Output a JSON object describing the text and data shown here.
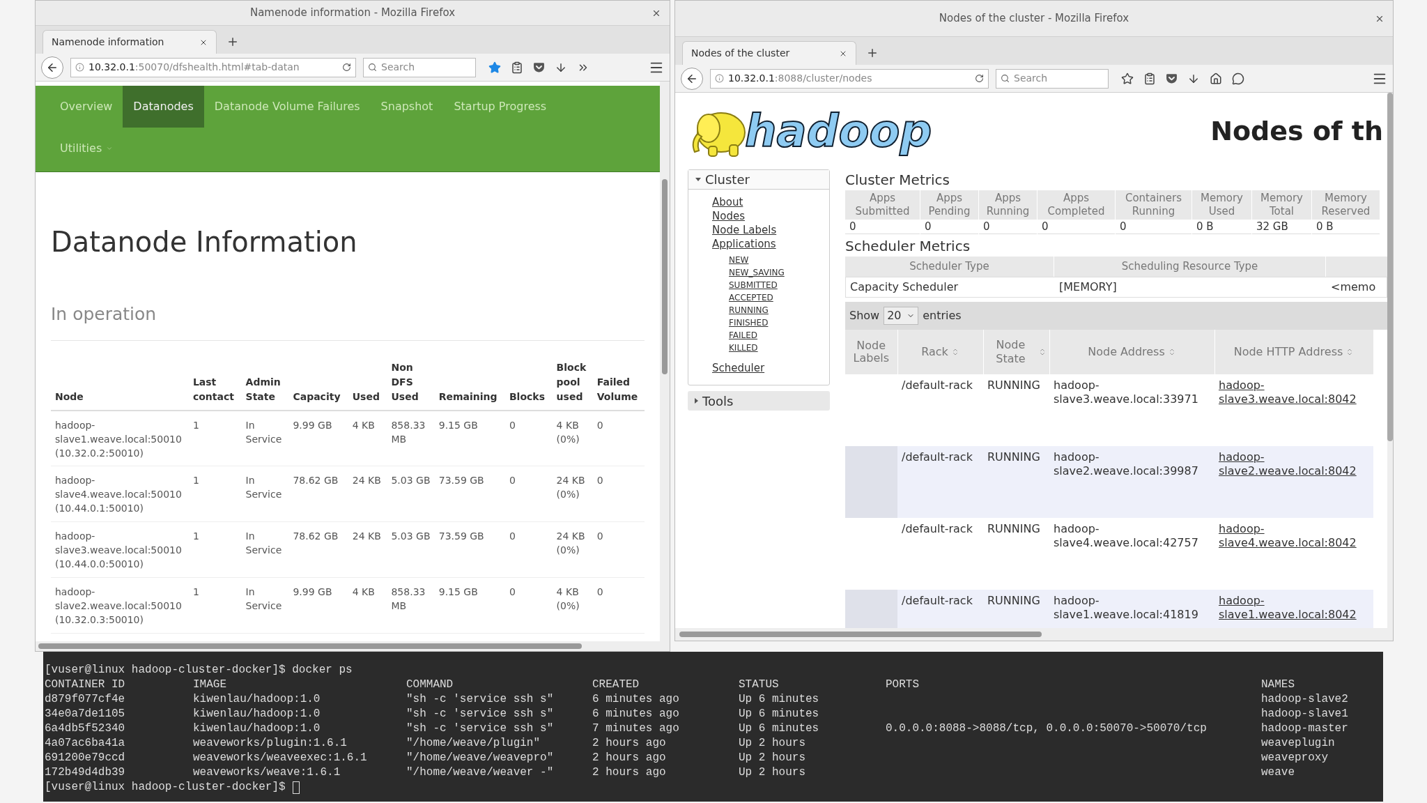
{
  "left_window": {
    "title": "Namenode information - Mozilla Firefox",
    "tab": "Namenode information",
    "url_host": "10.32.0.1",
    "url_path": ":50070/dfshealth.html#tab-datan",
    "search_placeholder": "Search",
    "bookmarked": true,
    "nav": [
      {
        "label": "Overview",
        "selected": false
      },
      {
        "label": "Datanodes",
        "selected": true
      },
      {
        "label": "Datanode Volume Failures",
        "selected": false
      },
      {
        "label": "Snapshot",
        "selected": false
      },
      {
        "label": "Startup Progress",
        "selected": false
      },
      {
        "label": "Utilities",
        "selected": false
      }
    ],
    "heading": "Datanode Information",
    "subheading": "In operation",
    "table": {
      "columns": [
        "Node",
        "Last contact",
        "Admin State",
        "Capacity",
        "Used",
        "Non DFS Used",
        "Remaining",
        "Blocks",
        "Block pool used",
        "Failed Volume"
      ],
      "rows": [
        [
          "hadoop-slave1.weave.local:50010 (10.32.0.2:50010)",
          "1",
          "In Service",
          "9.99 GB",
          "4 KB",
          "858.33 MB",
          "9.15 GB",
          "0",
          "4 KB (0%)",
          "0"
        ],
        [
          "hadoop-slave4.weave.local:50010 (10.44.0.1:50010)",
          "1",
          "In Service",
          "78.62 GB",
          "24 KB",
          "5.03 GB",
          "73.59 GB",
          "0",
          "24 KB (0%)",
          "0"
        ],
        [
          "hadoop-slave3.weave.local:50010 (10.44.0.0:50010)",
          "1",
          "In Service",
          "78.62 GB",
          "24 KB",
          "5.03 GB",
          "73.59 GB",
          "0",
          "24 KB (0%)",
          "0"
        ],
        [
          "hadoop-slave2.weave.local:50010 (10.32.0.3:50010)",
          "1",
          "In Service",
          "9.99 GB",
          "4 KB",
          "858.33 MB",
          "9.15 GB",
          "0",
          "4 KB (0%)",
          "0"
        ]
      ]
    }
  },
  "right_window": {
    "title": "Nodes of the cluster - Mozilla Firefox",
    "tab": "Nodes of the cluster",
    "url_host": "10.32.0.1",
    "url_path": ":8088/cluster/nodes",
    "search_placeholder": "Search",
    "bookmarked": false,
    "logo": "hadoop",
    "page_title": "Nodes of th",
    "sidebar": [
      {
        "label": "Cluster",
        "expanded": true,
        "items": [
          {
            "label": "About"
          },
          {
            "label": "Nodes"
          },
          {
            "label": "Node Labels"
          },
          {
            "label": "Applications",
            "children": [
              {
                "label": "NEW"
              },
              {
                "label": "NEW_SAVING"
              },
              {
                "label": "SUBMITTED"
              },
              {
                "label": "ACCEPTED"
              },
              {
                "label": "RUNNING"
              },
              {
                "label": "FINISHED"
              },
              {
                "label": "FAILED"
              },
              {
                "label": "KILLED"
              }
            ]
          },
          {
            "label": "Scheduler"
          }
        ]
      },
      {
        "label": "Tools",
        "expanded": false
      }
    ],
    "cluster_metrics": {
      "title": "Cluster Metrics",
      "columns": [
        "Apps Submitted",
        "Apps Pending",
        "Apps Running",
        "Apps Completed",
        "Containers Running",
        "Memory Used",
        "Memory Total",
        "Memory Reserved"
      ],
      "values": [
        "0",
        "0",
        "0",
        "0",
        "0",
        "0 B",
        "32 GB",
        "0 B"
      ]
    },
    "scheduler_metrics": {
      "title": "Scheduler Metrics",
      "columns": [
        "Scheduler Type",
        "Scheduling Resource Type"
      ],
      "row": [
        "Capacity Scheduler",
        "[MEMORY]",
        "<memo"
      ]
    },
    "entries": {
      "before": "Show",
      "value": "20",
      "after": "entries"
    },
    "nodes_table": {
      "columns": [
        "Node Labels",
        "Rack",
        "Node State",
        "Node Address",
        "Node HTTP Address"
      ],
      "rows": [
        [
          "",
          "/default-rack",
          "RUNNING",
          "hadoop-slave3.weave.local:33971",
          "hadoop-slave3.weave.local:8042"
        ],
        [
          "",
          "/default-rack",
          "RUNNING",
          "hadoop-slave2.weave.local:39987",
          "hadoop-slave2.weave.local:8042"
        ],
        [
          "",
          "/default-rack",
          "RUNNING",
          "hadoop-slave4.weave.local:42757",
          "hadoop-slave4.weave.local:8042"
        ],
        [
          "",
          "/default-rack",
          "RUNNING",
          "hadoop-slave1.weave.local:41819",
          "hadoop-slave1.weave.local:8042"
        ]
      ]
    }
  },
  "terminal": {
    "command_line": "[vuser@linux hadoop-cluster-docker]$ docker ps",
    "columns": [
      "CONTAINER ID",
      "IMAGE",
      "COMMAND",
      "CREATED",
      "STATUS",
      "PORTS",
      "NAMES"
    ],
    "rows": [
      [
        "d879f077cf4e",
        "kiwenlau/hadoop:1.0",
        "\"sh -c 'service ssh s\"",
        "6 minutes ago",
        "Up 6 minutes",
        "",
        "hadoop-slave2"
      ],
      [
        "34e0a7de1105",
        "kiwenlau/hadoop:1.0",
        "\"sh -c 'service ssh s\"",
        "6 minutes ago",
        "Up 6 minutes",
        "",
        "hadoop-slave1"
      ],
      [
        "6a4db5f52340",
        "kiwenlau/hadoop:1.0",
        "\"sh -c 'service ssh s\"",
        "7 minutes ago",
        "Up 6 minutes",
        "0.0.0.0:8088->8088/tcp, 0.0.0.0:50070->50070/tcp",
        "hadoop-master"
      ],
      [
        "4a07ac6ba41a",
        "weaveworks/plugin:1.6.1",
        "\"/home/weave/plugin\"",
        "2 hours ago",
        "Up 2 hours",
        "",
        "weaveplugin"
      ],
      [
        "691200e79ccd",
        "weaveworks/weaveexec:1.6.1",
        "\"/home/weave/weavepro\"",
        "2 hours ago",
        "Up 2 hours",
        "",
        "weaveproxy"
      ],
      [
        "172b49d4db39",
        "weaveworks/weave:1.6.1",
        "\"/home/weave/weaver -\"",
        "2 hours ago",
        "Up 2 hours",
        "",
        "weave"
      ]
    ],
    "prompt": "[vuser@linux hadoop-cluster-docker]$"
  }
}
